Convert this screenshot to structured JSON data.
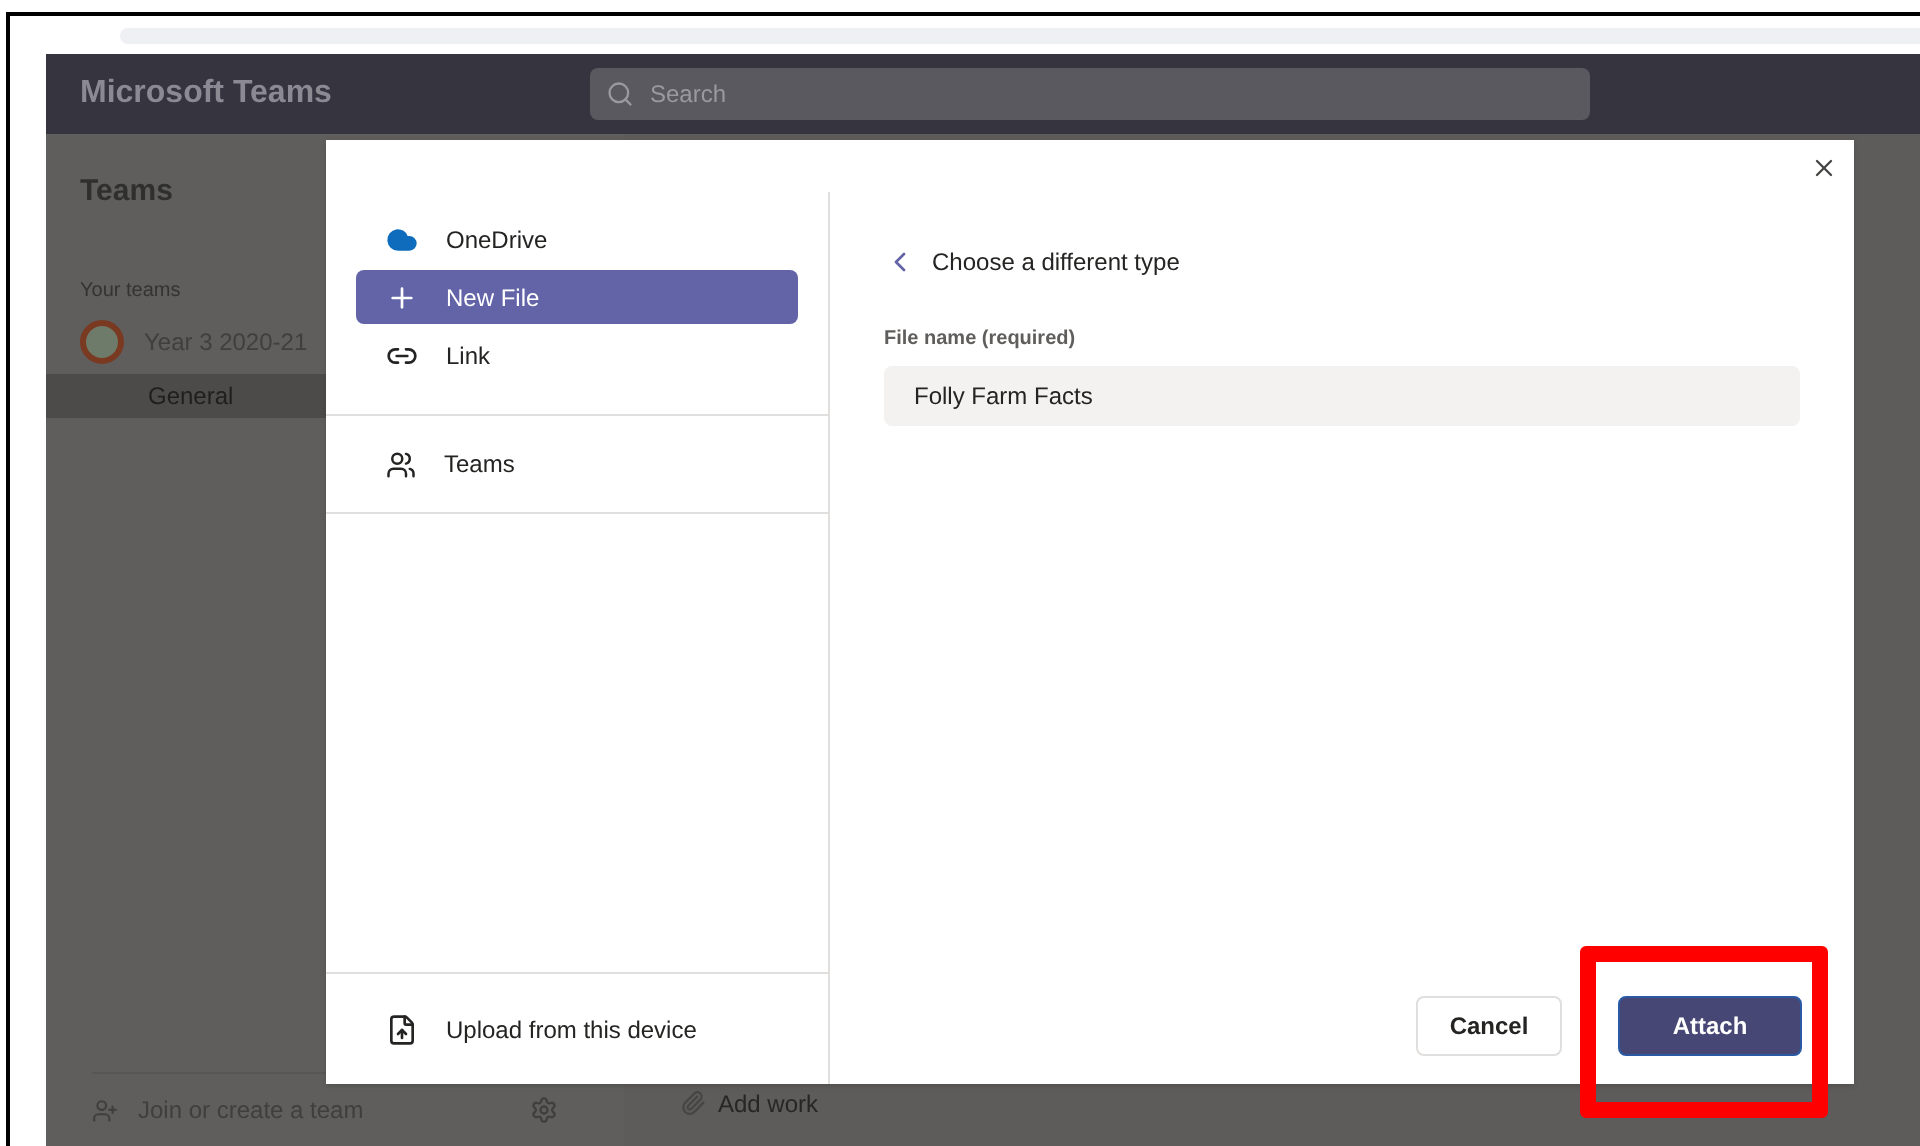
{
  "app": {
    "title": "Microsoft Teams",
    "search": {
      "placeholder": "Search"
    }
  },
  "sidebar": {
    "heading": "Teams",
    "section": "Your teams",
    "teams": [
      {
        "name": "Year 3 2020-21",
        "channels": [
          {
            "name": "General",
            "selected": true
          }
        ]
      }
    ],
    "footer": "Join or create a team"
  },
  "main": {
    "add_work": "Add work"
  },
  "dialog": {
    "sources": [
      {
        "label": "OneDrive",
        "kind": "cloud",
        "selected": false
      },
      {
        "label": "New File",
        "kind": "plus",
        "selected": true
      },
      {
        "label": "Link",
        "kind": "link",
        "selected": false
      }
    ],
    "teams_source": {
      "label": "Teams"
    },
    "upload": "Upload from this device",
    "back_link": "Choose a different type",
    "field": {
      "label": "File name (required)",
      "value": "Folly Farm Facts"
    },
    "buttons": [
      {
        "label": "Cancel",
        "kind": "secondary"
      },
      {
        "label": "Attach",
        "kind": "primary"
      }
    ]
  }
}
